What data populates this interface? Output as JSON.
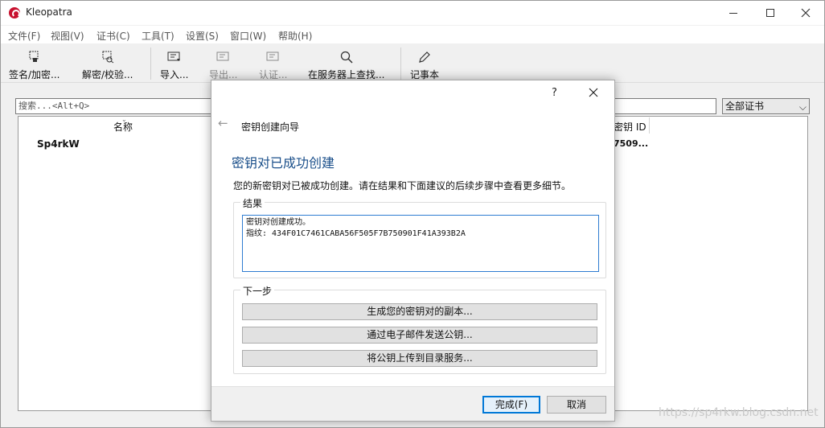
{
  "window": {
    "title": "Kleopatra",
    "controls": {
      "minimize": "minimize",
      "maximize": "maximize",
      "close": "close"
    }
  },
  "menu": [
    "文件(F)",
    "视图(V)",
    "证书(C)",
    "工具(T)",
    "设置(S)",
    "窗口(W)",
    "帮助(H)"
  ],
  "toolbar": {
    "sign_encrypt": "签名/加密...",
    "decrypt_verify": "解密/校验...",
    "import": "导入...",
    "export": "导出...",
    "certify": "认证...",
    "lookup_server": "在服务器上查找...",
    "notepad": "记事本"
  },
  "search": {
    "placeholder": "搜索...<Alt+Q>",
    "filter_selected": "全部证书"
  },
  "table": {
    "columns": {
      "name": "名称",
      "key_id": "密钥 ID"
    },
    "rows": [
      {
        "name": "Sp4rkW",
        "key_id": "7509..."
      }
    ]
  },
  "dialog": {
    "help": "?",
    "wizard_name": "密钥创建向导",
    "page_title": "密钥对已成功创建",
    "description": "您的新密钥对已被成功创建。请在结果和下面建议的后续步骤中查看更多细节。",
    "results_label": "结果",
    "result_lines": [
      "密钥对创建成功。",
      "指纹: 434F01C7461CABA56F505F7B750901F41A393B2A"
    ],
    "next_steps_label": "下一步",
    "actions": [
      "生成您的密钥对的副本...",
      "通过电子邮件发送公钥...",
      "将公钥上传到目录服务..."
    ],
    "finish": "完成(F)",
    "cancel": "取消"
  },
  "watermark": "https://sp4rkw.blog.csdn.net"
}
